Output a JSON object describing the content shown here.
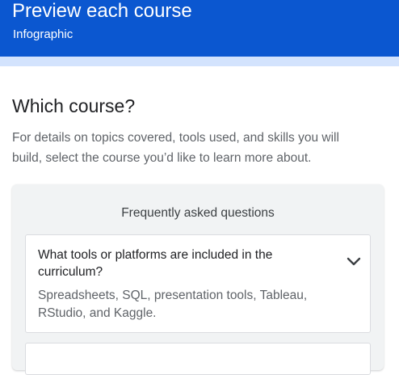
{
  "header": {
    "title": "Preview each course",
    "subtitle": "Infographic"
  },
  "section": {
    "heading": "Which course?",
    "description": "For details on topics covered, tools used, and skills you will build, select the course you’d like to learn more about."
  },
  "faq": {
    "title": "Frequently asked questions",
    "items": [
      {
        "question": "What tools or platforms are included in the curriculum?",
        "answer": "Spreadsheets, SQL, presentation tools, Tableau, RStudio, and Kaggle.",
        "expanded": true,
        "icon": "chevron-down-icon"
      }
    ]
  },
  "colors": {
    "header_bg": "#0b57d0",
    "band": "#d3e3fd",
    "card_bg": "#f1f3f4"
  }
}
